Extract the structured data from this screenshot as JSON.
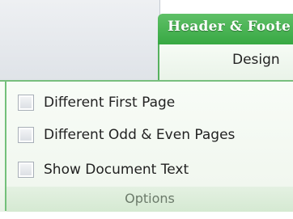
{
  "ribbon": {
    "contextual_tab_title": "Header & Foote",
    "active_tab_label": "Design"
  },
  "options_group": {
    "items": [
      {
        "label": "Different First Page",
        "checked": false
      },
      {
        "label": "Different Odd & Even Pages",
        "checked": false
      },
      {
        "label": "Show Document Text",
        "checked": false
      }
    ],
    "group_label": "Options"
  },
  "colors": {
    "contextual_green": "#37a843",
    "ribbon_background": "#f1f7ef",
    "group_label_background": "#d5e9d2"
  }
}
